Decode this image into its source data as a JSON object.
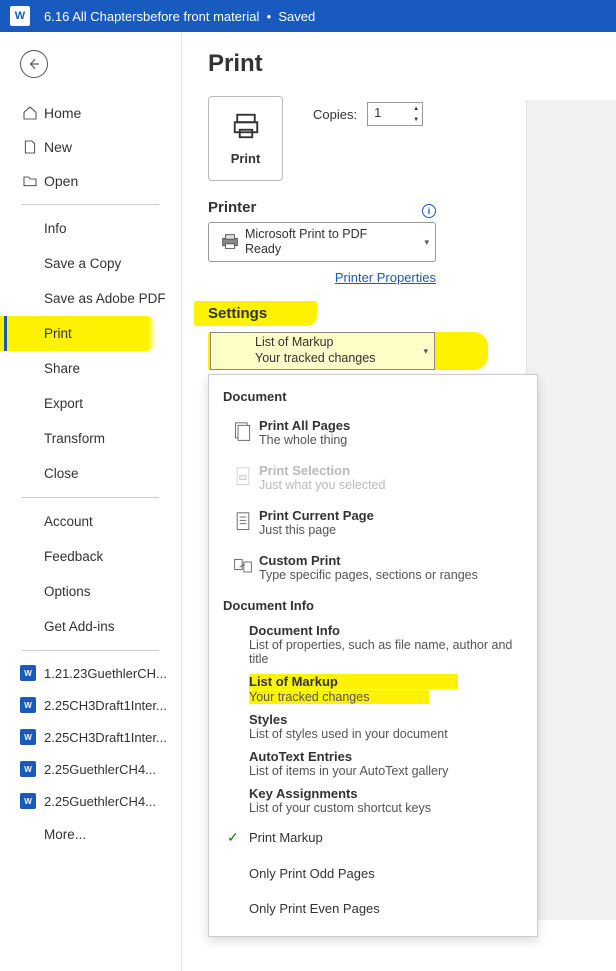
{
  "title_bar": {
    "doc_title": "6.16 All Chaptersbefore front material",
    "status": "Saved"
  },
  "nav": {
    "home": "Home",
    "new": "New",
    "open": "Open"
  },
  "sub": {
    "info": "Info",
    "save_copy": "Save a Copy",
    "save_adobe": "Save as Adobe PDF",
    "print": "Print",
    "share": "Share",
    "export": "Export",
    "transform": "Transform",
    "close": "Close",
    "account": "Account",
    "feedback": "Feedback",
    "options": "Options",
    "addins": "Get Add-ins"
  },
  "recent": {
    "r1": "1.21.23GuethlerCH...",
    "r2": "2.25CH3Draft1Inter...",
    "r3": "2.25CH3Draft1Inter...",
    "r4": "2.25GuethlerCH4...",
    "r5": "2.25GuethlerCH4...",
    "more": "More..."
  },
  "print": {
    "title": "Print",
    "button": "Print",
    "copies_label": "Copies:",
    "copies_value": "1",
    "printer_heading": "Printer",
    "printer_name": "Microsoft Print to PDF",
    "printer_status": "Ready",
    "printer_props": "Printer Properties",
    "settings_heading": "Settings",
    "settings_sel_title": "List of Markup",
    "settings_sel_sub": "Your tracked changes"
  },
  "panel": {
    "doc_heading": "Document",
    "all_pages": "Print All Pages",
    "all_pages_sub": "The whole thing",
    "selection": "Print Selection",
    "selection_sub": "Just what you selected",
    "current": "Print Current Page",
    "current_sub": "Just this page",
    "custom": "Custom Print",
    "custom_sub": "Type specific pages, sections or ranges",
    "docinfo_heading": "Document Info",
    "docinfo": "Document Info",
    "docinfo_sub": "List of properties, such as file name, author and title",
    "markup": "List of Markup",
    "markup_sub": "Your tracked changes",
    "styles": "Styles",
    "styles_sub": "List of styles used in your document",
    "autotext": "AutoText Entries",
    "autotext_sub": "List of items in your AutoText gallery",
    "keys": "Key Assignments",
    "keys_sub": "List of your custom shortcut keys",
    "print_markup": "Print Markup",
    "odd": "Only Print Odd Pages",
    "even": "Only Print Even Pages"
  }
}
